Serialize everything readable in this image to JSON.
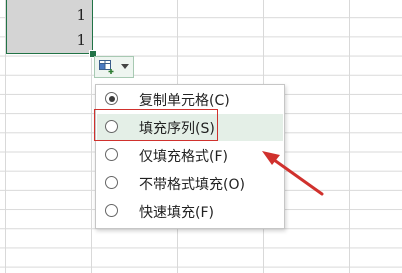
{
  "cells": {
    "value_1": "1",
    "value_2": "1"
  },
  "autofill": {
    "icon": "autofill-options-icon",
    "options": [
      {
        "label": "复制单元格(C)",
        "selected": true
      },
      {
        "label": "填充序列(S)",
        "selected": false,
        "highlighted": true
      },
      {
        "label": "仅填充格式(F)",
        "selected": false
      },
      {
        "label": "不带格式填充(O)",
        "selected": false
      },
      {
        "label": "快速填充(F)",
        "selected": false
      }
    ]
  },
  "annotation": {
    "color": "#d0312d"
  }
}
